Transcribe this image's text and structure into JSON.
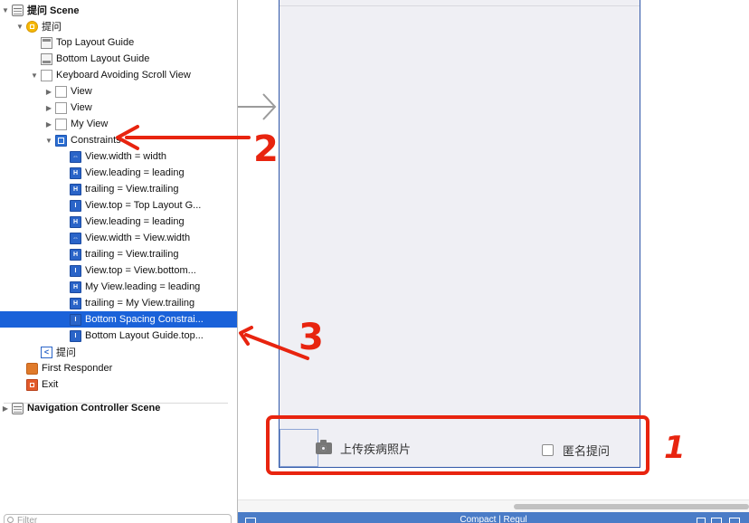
{
  "outline": {
    "rows": [
      {
        "label": "提问 Scene",
        "level": 0,
        "disc": "down",
        "icon": "scene",
        "bold": true
      },
      {
        "label": "提问",
        "level": 1,
        "disc": "down",
        "icon": "vc"
      },
      {
        "label": "Top Layout Guide",
        "level": 2,
        "disc": "",
        "icon": "guide-top"
      },
      {
        "label": "Bottom Layout Guide",
        "level": 2,
        "disc": "",
        "icon": "guide-bottom"
      },
      {
        "label": "Keyboard Avoiding Scroll View",
        "level": 2,
        "disc": "down",
        "icon": "view"
      },
      {
        "label": "View",
        "level": 3,
        "disc": "right",
        "icon": "view"
      },
      {
        "label": "View",
        "level": 3,
        "disc": "right",
        "icon": "view"
      },
      {
        "label": "My View",
        "level": 3,
        "disc": "right",
        "icon": "view"
      },
      {
        "label": "Constraints",
        "level": 3,
        "disc": "down",
        "icon": "constraints"
      },
      {
        "label": "View.width = width",
        "level": 4,
        "disc": "",
        "icon": "c-width"
      },
      {
        "label": "View.leading = leading",
        "level": 4,
        "disc": "",
        "icon": "c-leading"
      },
      {
        "label": "trailing = View.trailing",
        "level": 4,
        "disc": "",
        "icon": "c-trailing"
      },
      {
        "label": "View.top = Top Layout G...",
        "level": 4,
        "disc": "",
        "icon": "c-top"
      },
      {
        "label": "View.leading = leading",
        "level": 4,
        "disc": "",
        "icon": "c-leading"
      },
      {
        "label": "View.width = View.width",
        "level": 4,
        "disc": "",
        "icon": "c-width"
      },
      {
        "label": "trailing = View.trailing",
        "level": 4,
        "disc": "",
        "icon": "c-trailing"
      },
      {
        "label": "View.top = View.bottom...",
        "level": 4,
        "disc": "",
        "icon": "c-top"
      },
      {
        "label": "My View.leading = leading",
        "level": 4,
        "disc": "",
        "icon": "c-leading"
      },
      {
        "label": "trailing = My View.trailing",
        "level": 4,
        "disc": "",
        "icon": "c-trailing"
      },
      {
        "label": "Bottom Spacing Constrai...",
        "level": 4,
        "disc": "",
        "icon": "c-bottom",
        "selected": true
      },
      {
        "label": "Bottom Layout Guide.top...",
        "level": 4,
        "disc": "",
        "icon": "c-bottom"
      },
      {
        "label": "提问",
        "level": 2,
        "disc": "",
        "icon": "back"
      },
      {
        "label": "First Responder",
        "level": 1,
        "disc": "",
        "icon": "first-responder"
      },
      {
        "label": "Exit",
        "level": 1,
        "disc": "",
        "icon": "exit"
      },
      {
        "label": "Navigation Controller Scene",
        "level": 0,
        "disc": "right",
        "icon": "scene",
        "bold": true,
        "gapBefore": true
      }
    ],
    "filter_placeholder": "Filter"
  },
  "canvas": {
    "camera_label": "上传疾病照片",
    "anonymous_label": "匿名提问",
    "status_text": "Compact | Regul"
  },
  "annotations": {
    "label_1": "1",
    "label_2": "2",
    "label_3": "3",
    "color": "#e8240f"
  }
}
